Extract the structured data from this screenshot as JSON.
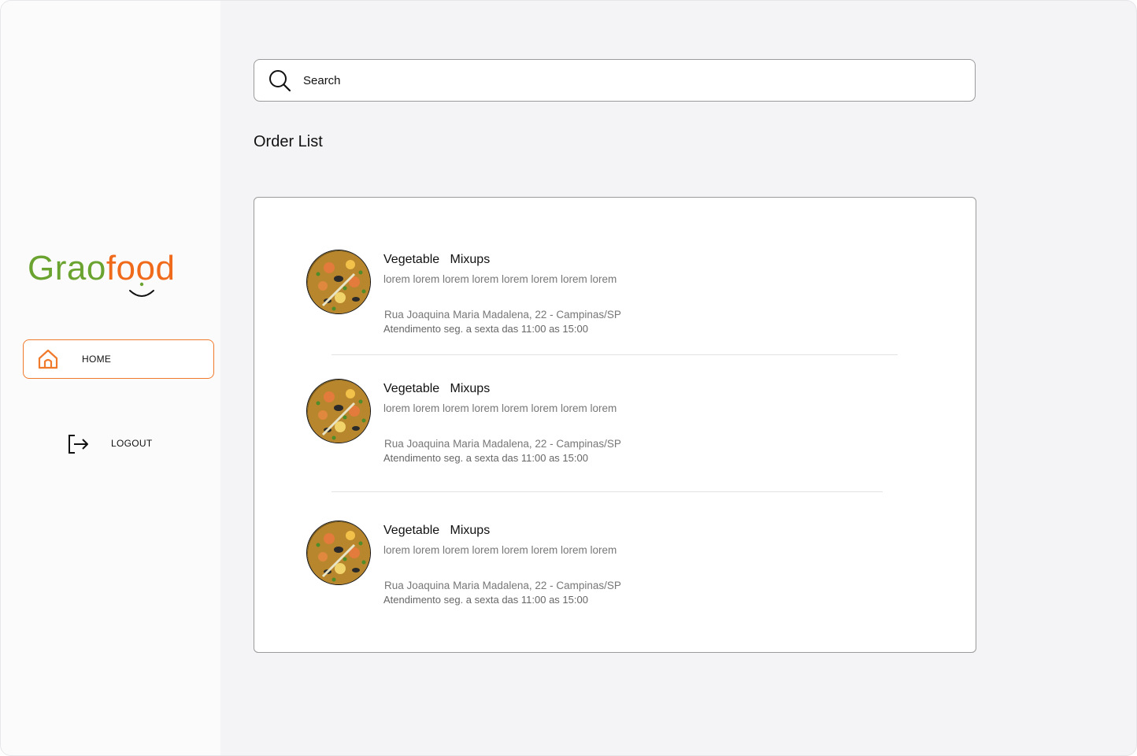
{
  "app": {
    "logo": {
      "part1": "Grao",
      "part2": "food"
    },
    "colors": {
      "brand_green": "#6aa32f",
      "brand_orange": "#f06a1b",
      "accent": "#f07a2c"
    }
  },
  "sidebar": {
    "items": [
      {
        "label": "HOME",
        "icon": "home-icon",
        "active": true
      },
      {
        "label": "LOGOUT",
        "icon": "logout-icon",
        "active": false
      }
    ]
  },
  "search": {
    "placeholder": "Search",
    "value": ""
  },
  "main": {
    "title": "Order List",
    "orders": [
      {
        "name": "Vegetable   Mixups",
        "description": "lorem lorem lorem lorem lorem lorem lorem lorem",
        "address": "Rua Joaquina Maria Madalena, 22 - Campinas/SP",
        "hours": "Atendimento seg. a sexta das 11:00 as 15:00",
        "image": "paella-dish-image"
      },
      {
        "name": "Vegetable   Mixups",
        "description": "lorem lorem lorem lorem lorem lorem lorem lorem",
        "address": "Rua Joaquina Maria Madalena, 22 - Campinas/SP",
        "hours": "Atendimento seg. a sexta das 11:00 as 15:00",
        "image": "paella-dish-image"
      },
      {
        "name": "Vegetable   Mixups",
        "description": "lorem lorem lorem lorem lorem lorem lorem lorem",
        "address": "Rua Joaquina Maria Madalena, 22 - Campinas/SP",
        "hours": "Atendimento seg. a sexta das 11:00 as 15:00",
        "image": "paella-dish-image"
      }
    ]
  }
}
